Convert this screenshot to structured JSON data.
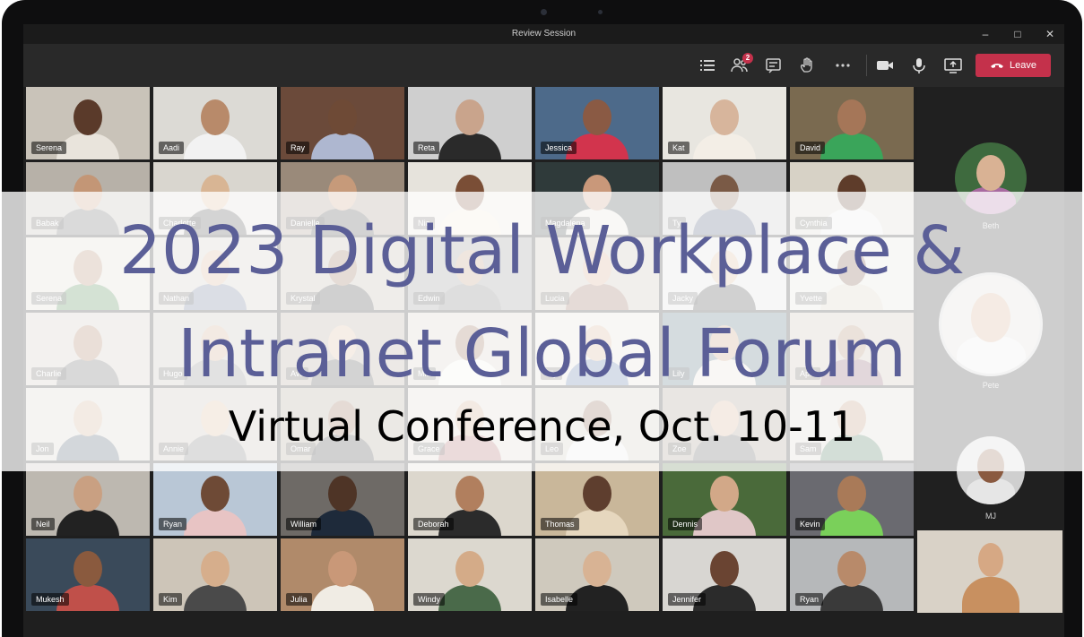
{
  "window": {
    "title": "Review Session"
  },
  "toolbar": {
    "participants_badge": "2",
    "leave_label": "Leave"
  },
  "participants": [
    {
      "name": "Serena",
      "bg": "#c9c3b9",
      "skin": "#5a3a2a",
      "shirt": "#e9e4dc"
    },
    {
      "name": "Aadi",
      "bg": "#dcdad5",
      "skin": "#b88a6a",
      "shirt": "#f2f2f2"
    },
    {
      "name": "Ray",
      "bg": "#6b4a3a",
      "skin": "#6e4a36",
      "shirt": "#aeb7d0"
    },
    {
      "name": "Reta",
      "bg": "#cfcfcf",
      "skin": "#c9a48c",
      "shirt": "#2a2a2a"
    },
    {
      "name": "Jessica",
      "bg": "#4d6a8a",
      "skin": "#8a5a44",
      "shirt": "#d2344d"
    },
    {
      "name": "Kat",
      "bg": "#e8e6e0",
      "skin": "#d7b59c",
      "shirt": "#f3eee6"
    },
    {
      "name": "David",
      "bg": "#7a6a50",
      "skin": "#a57658",
      "shirt": "#3aa55a"
    },
    {
      "name": "Babak",
      "bg": "#b7b1a8",
      "skin": "#c39676",
      "shirt": "#585858"
    },
    {
      "name": "Charlotte",
      "bg": "#d9d6cf",
      "skin": "#d8b594",
      "shirt": "#3b3b3b"
    },
    {
      "name": "Danielle",
      "bg": "#9a8a7a",
      "skin": "#c69a7a",
      "shirt": "#3a3a3a"
    },
    {
      "name": "Nia",
      "bg": "#e6e3dc",
      "skin": "#7a4e36",
      "shirt": "#f0e6d6"
    },
    {
      "name": "Magdalena",
      "bg": "#2f3a3a",
      "skin": "#c9987a",
      "shirt": "#e5e0d6"
    },
    {
      "name": "Ty",
      "bg": "#bfbfbf",
      "skin": "#7a5a46",
      "shirt": "#3b4b6b"
    },
    {
      "name": "Cynthia",
      "bg": "#d7d2c6",
      "skin": "#5e3c2a",
      "shirt": "#e8e8e8"
    },
    {
      "name": "Serena",
      "bg": "#d9d4ca",
      "skin": "#a77c5c",
      "shirt": "#3e7a3e"
    },
    {
      "name": "Nathan",
      "bg": "#c9c4bb",
      "skin": "#d1a98a",
      "shirt": "#5a6a8a"
    },
    {
      "name": "Krystal",
      "bg": "#b4aba0",
      "skin": "#8a6046",
      "shirt": "#2a2a2a"
    },
    {
      "name": "Edwin",
      "bg": "#8a8a8a",
      "skin": "#b58d6d",
      "shirt": "#6a6a6a"
    },
    {
      "name": "Lucia",
      "bg": "#c0b5a7",
      "skin": "#cf9f82",
      "shirt": "#8a5a4a"
    },
    {
      "name": "Jacky",
      "bg": "#dcdcdc",
      "skin": "#d7b08e",
      "shirt": "#2f2f2f"
    },
    {
      "name": "Yvette",
      "bg": "#e0ddd6",
      "skin": "#6e4632",
      "shirt": "#cfc7b5"
    },
    {
      "name": "Charlie",
      "bg": "#c7c0b4",
      "skin": "#a0704e",
      "shirt": "#555555"
    },
    {
      "name": "Hugo",
      "bg": "#bcb7ad",
      "skin": "#c8a080",
      "shirt": "#7a7a7a"
    },
    {
      "name": "Ava",
      "bg": "#a79a8c",
      "skin": "#d6b193",
      "shirt": "#3a3a3a"
    },
    {
      "name": "Mia",
      "bg": "#cfcac0",
      "skin": "#8b5d42",
      "shirt": "#f0efe8"
    },
    {
      "name": "Lily",
      "bg": "#dedad1",
      "skin": "#d3aa8a",
      "shirt": "#4a6a9a"
    },
    {
      "name": "Lily",
      "bg": "#3f6070",
      "skin": "#c19070",
      "shirt": "#e5dccf"
    },
    {
      "name": "April",
      "bg": "#c4b8a8",
      "skin": "#a57b5c",
      "shirt": "#7a4a5a"
    },
    {
      "name": "Jon",
      "bg": "#d0ccc4",
      "skin": "#c9a384",
      "shirt": "#3a4a5a"
    },
    {
      "name": "Annie",
      "bg": "#bfb8ad",
      "skin": "#d4b08f",
      "shirt": "#6a6a6a"
    },
    {
      "name": "Omar",
      "bg": "#a4998b",
      "skin": "#8a5c40",
      "shirt": "#2f2f2f"
    },
    {
      "name": "Grace",
      "bg": "#d8d3c9",
      "skin": "#c7a082",
      "shirt": "#a55a5a"
    },
    {
      "name": "Leo",
      "bg": "#c9c3b7",
      "skin": "#7e5640",
      "shirt": "#e6e6e6"
    },
    {
      "name": "Zoe",
      "bg": "#9a8f82",
      "skin": "#d2aa88",
      "shirt": "#4a4a4a"
    },
    {
      "name": "Sam",
      "bg": "#d6d1c6",
      "skin": "#b8896a",
      "shirt": "#3a6a4a"
    },
    {
      "name": "Neil",
      "bg": "#bdb8b0",
      "skin": "#c9a082",
      "shirt": "#222222"
    },
    {
      "name": "Ryan",
      "bg": "#b9c7d6",
      "skin": "#6e4a36",
      "shirt": "#e8c4c4"
    },
    {
      "name": "William",
      "bg": "#6e6a66",
      "skin": "#4e3426",
      "shirt": "#1e2a3a"
    },
    {
      "name": "Deborah",
      "bg": "#dcd7cd",
      "skin": "#b17f5e",
      "shirt": "#2b2b2b"
    },
    {
      "name": "Thomas",
      "bg": "#c9b79a",
      "skin": "#5e3e2e",
      "shirt": "#e6d7be"
    },
    {
      "name": "Dennis",
      "bg": "#4a6a3a",
      "skin": "#d2a888",
      "shirt": "#e0c7c7"
    },
    {
      "name": "Kevin",
      "bg": "#6a6a70",
      "skin": "#a97a58",
      "shirt": "#7ad05a"
    },
    {
      "name": "Mukesh",
      "bg": "#3a4a5a",
      "skin": "#8a5a3e",
      "shirt": "#c0504a"
    },
    {
      "name": "Kim",
      "bg": "#cdc5b8",
      "skin": "#d6ae8c",
      "shirt": "#4a4a4a"
    },
    {
      "name": "Julia",
      "bg": "#b08a6a",
      "skin": "#c99878",
      "shirt": "#f0ece4"
    },
    {
      "name": "Windy",
      "bg": "#dcd8cf",
      "skin": "#d4ab88",
      "shirt": "#4a6a4a"
    },
    {
      "name": "Isabelle",
      "bg": "#cfc9bd",
      "skin": "#d8b394",
      "shirt": "#222222"
    },
    {
      "name": "Jennifer",
      "bg": "#d8d6d2",
      "skin": "#6a4432",
      "shirt": "#2b2b2b"
    },
    {
      "name": "Ryan",
      "bg": "#b6b8ba",
      "skin": "#b88a6a",
      "shirt": "#3a3a3a"
    }
  ],
  "side_panel": [
    {
      "name": "Beth",
      "bg": "#3e6a3e",
      "skin": "#d9b294",
      "shirt": "#a86aa0"
    },
    {
      "name": "Pete",
      "bg": "#d8d6d2",
      "skin": "#d0a686",
      "shirt": "#e8e8e8"
    },
    {
      "name": "MJ",
      "bg": "#cfcfcf",
      "skin": "#8a5a40",
      "shirt": "#e6e6e6"
    }
  ],
  "self_view": {
    "skin": "#d6a884",
    "shirt": "#c89060",
    "bg": "#d9d2c7"
  },
  "banner": {
    "title_line1": "2023 Digital Workplace &",
    "title_line2": "Intranet Global Forum",
    "subtitle": "Virtual Conference, Oct. 10-11"
  },
  "colors": {
    "leave_red": "#c4314b",
    "banner_title": "#5b5f97"
  }
}
